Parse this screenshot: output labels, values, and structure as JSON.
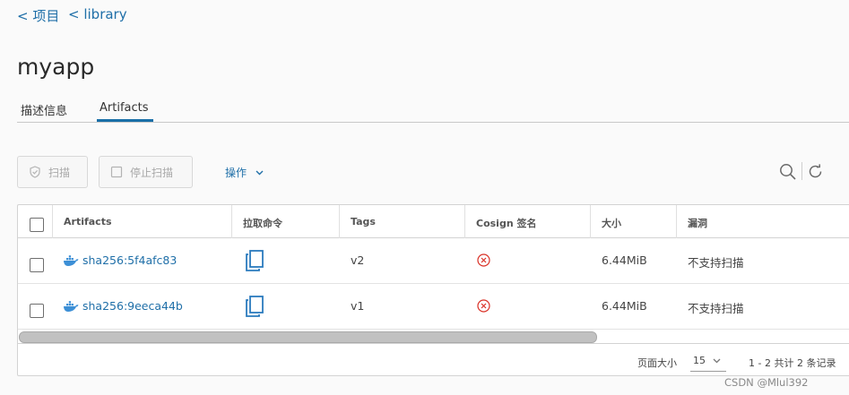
{
  "breadcrumbs": {
    "project": "< 项目",
    "library": "< library"
  },
  "page": {
    "title": "myapp"
  },
  "tabs": [
    {
      "label": "描述信息",
      "active": false
    },
    {
      "label": "Artifacts",
      "active": true
    }
  ],
  "toolbar": {
    "scan_label": "扫描",
    "stop_scan_label": "停止扫描",
    "actions_label": "操作",
    "search_icon": "search-icon",
    "refresh_icon": "refresh-icon"
  },
  "table": {
    "columns": [
      "Artifacts",
      "拉取命令",
      "Tags",
      "Cosign 签名",
      "大小",
      "漏洞"
    ],
    "rows": [
      {
        "artifact": "sha256:5f4afc83",
        "tag": "v2",
        "size": "6.44MiB",
        "vulnerabilities": "不支持扫描"
      },
      {
        "artifact": "sha256:9eeca44b",
        "tag": "v1",
        "size": "6.44MiB",
        "vulnerabilities": "不支持扫描"
      }
    ]
  },
  "pagination": {
    "page_size_label": "页面大小",
    "page_size": "15",
    "summary": "1 - 2 共计 2 条记录"
  },
  "watermark": "CSDN @Mlul392",
  "colors": {
    "link": "#1f6fa8",
    "error": "#d93025",
    "accent": "#1a6fa8"
  }
}
